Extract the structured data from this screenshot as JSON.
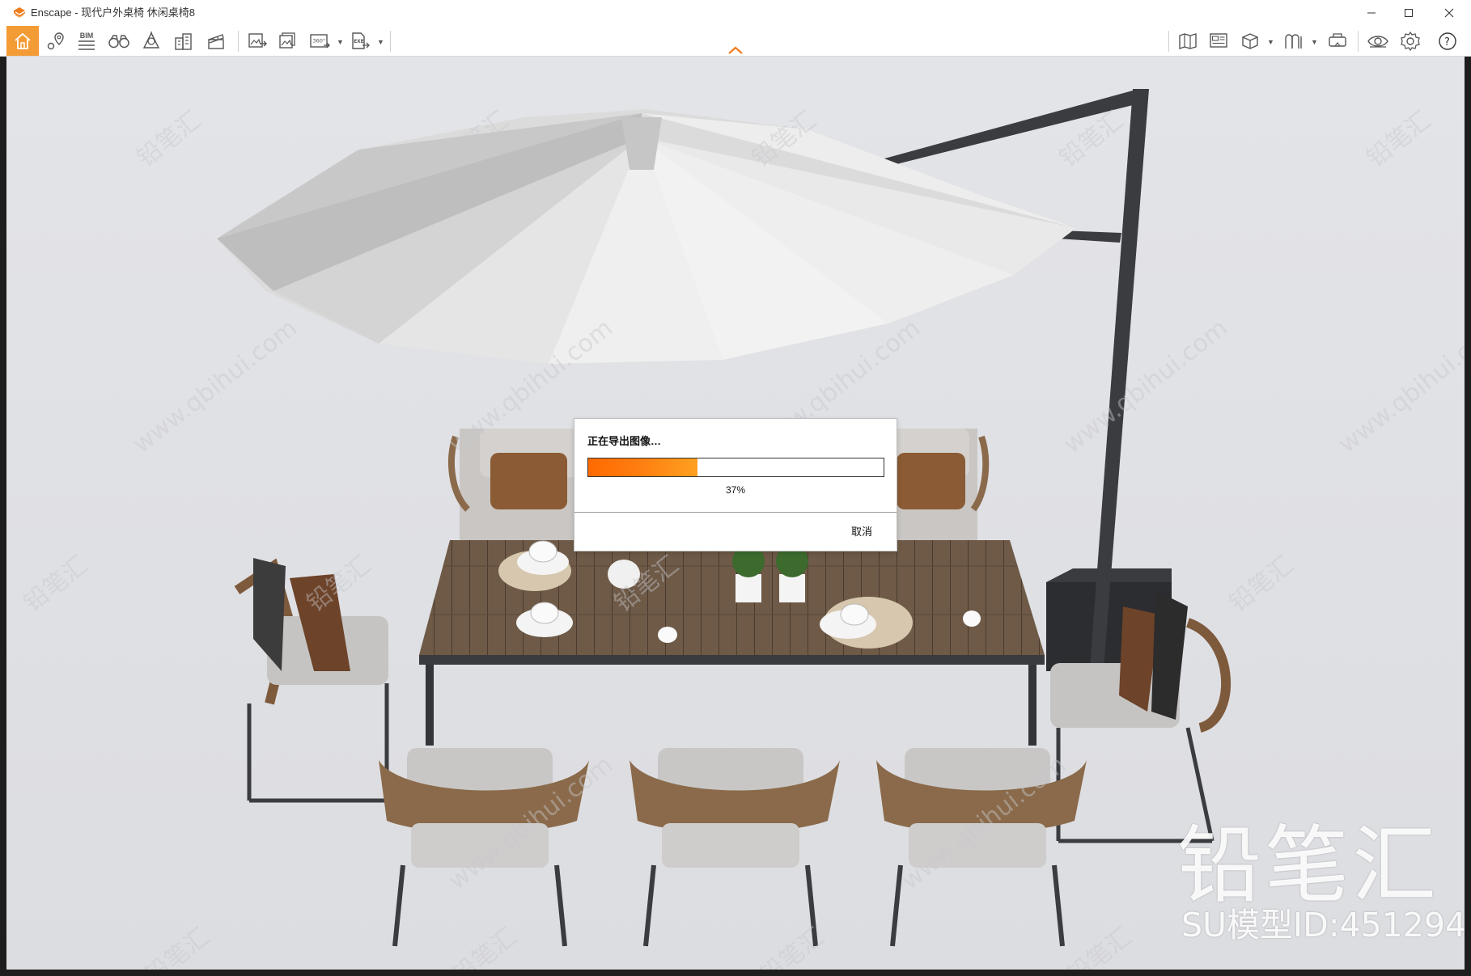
{
  "window": {
    "app_name": "Enscape",
    "title": "Enscape - 现代户外桌椅 休闲桌椅8",
    "controls": [
      "minimize",
      "maximize",
      "close"
    ]
  },
  "toolbar": {
    "home_icon": "home-icon",
    "bim_label": "BIM",
    "pano_label": "360°",
    "exe_label": "EXE",
    "help_label": "?",
    "accent_color": "#f39b35"
  },
  "dialog": {
    "title": "正在导出图像…",
    "progress_percent": 37,
    "progress_label": "37%",
    "cancel_label": "取消",
    "progress_color": "#ff6a00"
  },
  "watermark": {
    "logo_text": "铅笔汇",
    "model_id": "SU模型ID:451294",
    "diagonal_text": "www.qbihui.com",
    "diagonal_brand": "铅笔汇"
  }
}
